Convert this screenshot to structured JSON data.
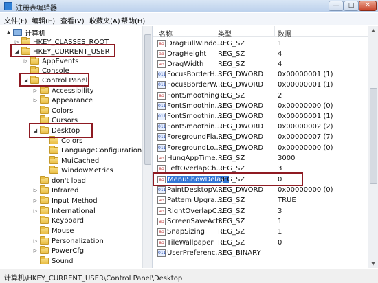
{
  "window": {
    "title": "注册表编辑器",
    "min_glyph": "—",
    "max_glyph": "□",
    "close_glyph": "✕"
  },
  "menu": [
    "文件(F)",
    "编辑(E)",
    "查看(V)",
    "收藏夹(A)",
    "帮助(H)"
  ],
  "tree": {
    "items": [
      {
        "label": "计算机",
        "arrow": "▲",
        "icon": "computer-icon"
      },
      {
        "label": "HKEY_CLASSES_ROOT",
        "arrow": "▷",
        "icon": "folder-icon"
      },
      {
        "label": "HKEY_CURRENT_USER",
        "arrow": "◢",
        "icon": "folder-icon"
      },
      {
        "label": "AppEvents",
        "arrow": "▷",
        "icon": "folder-icon"
      },
      {
        "label": "Console",
        "arrow": "",
        "icon": "folder-icon"
      },
      {
        "label": "Control Panel",
        "arrow": "◢",
        "icon": "folder-icon"
      },
      {
        "label": "Accessibility",
        "arrow": "▷",
        "icon": "folder-icon"
      },
      {
        "label": "Appearance",
        "arrow": "▷",
        "icon": "folder-icon"
      },
      {
        "label": "Colors",
        "arrow": "",
        "icon": "folder-icon"
      },
      {
        "label": "Cursors",
        "arrow": "",
        "icon": "folder-icon"
      },
      {
        "label": "Desktop",
        "arrow": "◢",
        "icon": "folder-icon"
      },
      {
        "label": "Colors",
        "arrow": "",
        "icon": "folder-icon"
      },
      {
        "label": "LanguageConfiguration",
        "arrow": "",
        "icon": "folder-icon"
      },
      {
        "label": "MuiCached",
        "arrow": "",
        "icon": "folder-icon"
      },
      {
        "label": "WindowMetrics",
        "arrow": "",
        "icon": "folder-icon"
      },
      {
        "label": "don't load",
        "arrow": "",
        "icon": "folder-icon"
      },
      {
        "label": "Infrared",
        "arrow": "▷",
        "icon": "folder-icon"
      },
      {
        "label": "Input Method",
        "arrow": "▷",
        "icon": "folder-icon"
      },
      {
        "label": "International",
        "arrow": "▷",
        "icon": "folder-icon"
      },
      {
        "label": "Keyboard",
        "arrow": "",
        "icon": "folder-icon"
      },
      {
        "label": "Mouse",
        "arrow": "",
        "icon": "folder-icon"
      },
      {
        "label": "Personalization",
        "arrow": "▷",
        "icon": "folder-icon"
      },
      {
        "label": "PowerCfg",
        "arrow": "▷",
        "icon": "folder-icon"
      },
      {
        "label": "Sound",
        "arrow": "",
        "icon": "folder-icon"
      }
    ]
  },
  "list": {
    "headers": {
      "name": "名称",
      "type": "类型",
      "data": "数据"
    },
    "rows": [
      {
        "icon": "ab",
        "name": "DragFullWindo...",
        "type": "REG_SZ",
        "data": "1"
      },
      {
        "icon": "ab",
        "name": "DragHeight",
        "type": "REG_SZ",
        "data": "4"
      },
      {
        "icon": "ab",
        "name": "DragWidth",
        "type": "REG_SZ",
        "data": "4"
      },
      {
        "icon": "bin",
        "name": "FocusBorderH...",
        "type": "REG_DWORD",
        "data": "0x00000001 (1)"
      },
      {
        "icon": "bin",
        "name": "FocusBorderW...",
        "type": "REG_DWORD",
        "data": "0x00000001 (1)"
      },
      {
        "icon": "ab",
        "name": "FontSmoothing",
        "type": "REG_SZ",
        "data": "2"
      },
      {
        "icon": "bin",
        "name": "FontSmoothin...",
        "type": "REG_DWORD",
        "data": "0x00000000 (0)"
      },
      {
        "icon": "bin",
        "name": "FontSmoothin...",
        "type": "REG_DWORD",
        "data": "0x00000001 (1)"
      },
      {
        "icon": "bin",
        "name": "FontSmoothin...",
        "type": "REG_DWORD",
        "data": "0x00000002 (2)"
      },
      {
        "icon": "bin",
        "name": "ForegroundFla...",
        "type": "REG_DWORD",
        "data": "0x00000007 (7)"
      },
      {
        "icon": "bin",
        "name": "ForegroundLo...",
        "type": "REG_DWORD",
        "data": "0x00000000 (0)"
      },
      {
        "icon": "ab",
        "name": "HungAppTime...",
        "type": "REG_SZ",
        "data": "3000"
      },
      {
        "icon": "ab",
        "name": "LeftOverlapCh...",
        "type": "REG_SZ",
        "data": "3"
      },
      {
        "icon": "ab",
        "name": "MenuShowDelay",
        "type": "REG_SZ",
        "data": "0"
      },
      {
        "icon": "bin",
        "name": "PaintDesktopV...",
        "type": "REG_DWORD",
        "data": "0x00000000 (0)"
      },
      {
        "icon": "ab",
        "name": "Pattern Upgra...",
        "type": "REG_SZ",
        "data": "TRUE"
      },
      {
        "icon": "ab",
        "name": "RightOverlapC...",
        "type": "REG_SZ",
        "data": "3"
      },
      {
        "icon": "ab",
        "name": "ScreenSaveActi...",
        "type": "REG_SZ",
        "data": "1"
      },
      {
        "icon": "ab",
        "name": "SnapSizing",
        "type": "REG_SZ",
        "data": "1"
      },
      {
        "icon": "ab",
        "name": "TileWallpaper",
        "type": "REG_SZ",
        "data": "0"
      },
      {
        "icon": "bin",
        "name": "UserPreferenc...",
        "type": "REG_BINARY",
        "data": ""
      }
    ]
  },
  "status": "计算机\\HKEY_CURRENT_USER\\Control Panel\\Desktop",
  "colors": {
    "highlight_box": "#8e1a22",
    "selection": "#3375d6"
  }
}
